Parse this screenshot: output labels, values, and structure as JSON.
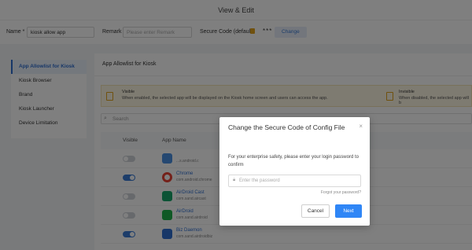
{
  "header": {
    "title": "View & Edit"
  },
  "form": {
    "name_label": "Name *",
    "name_value": "kiosk allow app",
    "remark_label": "Remark",
    "remark_placeholder": "Please enter Remark",
    "secure_code_label": "Secure Code (default:",
    "secure_code_value": "***",
    "change_button": "Change"
  },
  "sidebar": {
    "items": [
      {
        "label": "App Allowlist for Kiosk",
        "active": true
      },
      {
        "label": "Kiosk Browser"
      },
      {
        "label": "Brand"
      },
      {
        "label": "Kiosk Launcher"
      },
      {
        "label": "Device Limitation"
      }
    ]
  },
  "panel": {
    "title": "App Allowlist for Kiosk",
    "visible_title": "Visible",
    "visible_desc": "When enabled, the selected app will be displayed on the Kiosk home screen and users can access the app.",
    "invisible_title": "Invisible",
    "invisible_desc": "When disabled, the selected app will b",
    "search_placeholder": "Search",
    "columns": {
      "visible": "Visible",
      "app_name": "App Name"
    }
  },
  "apps": [
    {
      "name": "",
      "package": "...s.android.c",
      "visible": false,
      "icon": "folder-icon",
      "color": "#4a90e2"
    },
    {
      "name": "Chrome",
      "package": "com.android.chrome",
      "visible": true,
      "icon": "chrome-icon",
      "color": "#e94235"
    },
    {
      "name": "AirDroid Cast",
      "package": "com.sand.aircast",
      "visible": false,
      "icon": "airdroid-cast-icon",
      "color": "#17a66b"
    },
    {
      "name": "AirDroid",
      "package": "com.sand.airdroid",
      "visible": false,
      "icon": "airdroid-icon",
      "color": "#1fb24a"
    },
    {
      "name": "Biz Daemon",
      "package": "com.sand.airdroidbiz",
      "visible": true,
      "icon": "biz-daemon-icon",
      "color": "#2f6fd0"
    }
  ],
  "modal": {
    "title": "Change the Secure Code of Config File",
    "body": "For your enterprise safety, please enter your login password to confirm",
    "password_placeholder": "Enter the password",
    "forgot": "Forgot your password?",
    "cancel": "Cancel",
    "next": "Next",
    "close_glyph": "×"
  },
  "colors": {
    "accent": "#2f86f6",
    "warning": "#e0a21c"
  }
}
